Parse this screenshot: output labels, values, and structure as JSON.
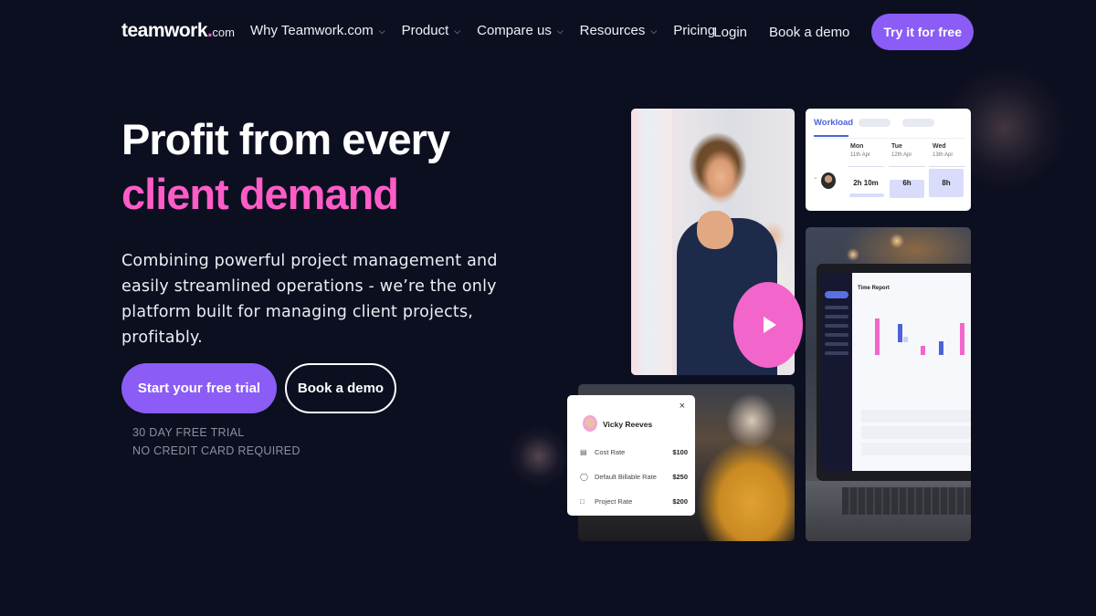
{
  "brand": {
    "name": "teamwork",
    "dot": ".",
    "suffix": "com"
  },
  "nav": {
    "links": [
      {
        "label": "Why Teamwork.com",
        "has_dropdown": true
      },
      {
        "label": "Product",
        "has_dropdown": true
      },
      {
        "label": "Compare us",
        "has_dropdown": true
      },
      {
        "label": "Resources",
        "has_dropdown": true
      },
      {
        "label": "Pricing",
        "has_dropdown": false
      }
    ],
    "login": "Login",
    "book_demo": "Book a demo",
    "try_free": "Try it for free",
    "chevron": "⌄"
  },
  "hero": {
    "headline_line1": "Profit from every",
    "headline_line2": "client demand",
    "lead": "Combining powerful project management and easily streamlined operations - we’re the only platform built for managing client projects, profitably.",
    "cta_primary": "Start your free trial",
    "cta_secondary": "Book a demo",
    "fineprint_line1": "30 DAY FREE TRIAL",
    "fineprint_line2": "NO CREDIT CARD REQUIRED"
  },
  "media": {
    "play_icon": "play",
    "workload": {
      "tab": "Workload",
      "days": [
        {
          "day": "Mon",
          "date": "11th Apr",
          "value": "2h 10m"
        },
        {
          "day": "Tue",
          "date": "12th Apr",
          "value": "6h"
        },
        {
          "day": "Wed",
          "date": "13th Apr",
          "value": "8h"
        }
      ],
      "expand_icon": "⌄"
    },
    "rate_card": {
      "close": "×",
      "name": "Vicky Reeves",
      "rows": [
        {
          "icon": "💵",
          "label": "Cost Rate",
          "value": "$100"
        },
        {
          "icon": "💰",
          "label": "Default Billable Rate",
          "value": "$250"
        },
        {
          "icon": "🗀",
          "label": "Project Rate",
          "value": "$200"
        }
      ]
    },
    "laptop": {
      "screen_title": "Time Report"
    }
  },
  "colors": {
    "background": "#0c0f20",
    "accent_purple": "#8b5cf6",
    "accent_pink": "#ff5cc8",
    "play_pink": "#f266cc",
    "workload_blue": "#4a63d8"
  }
}
